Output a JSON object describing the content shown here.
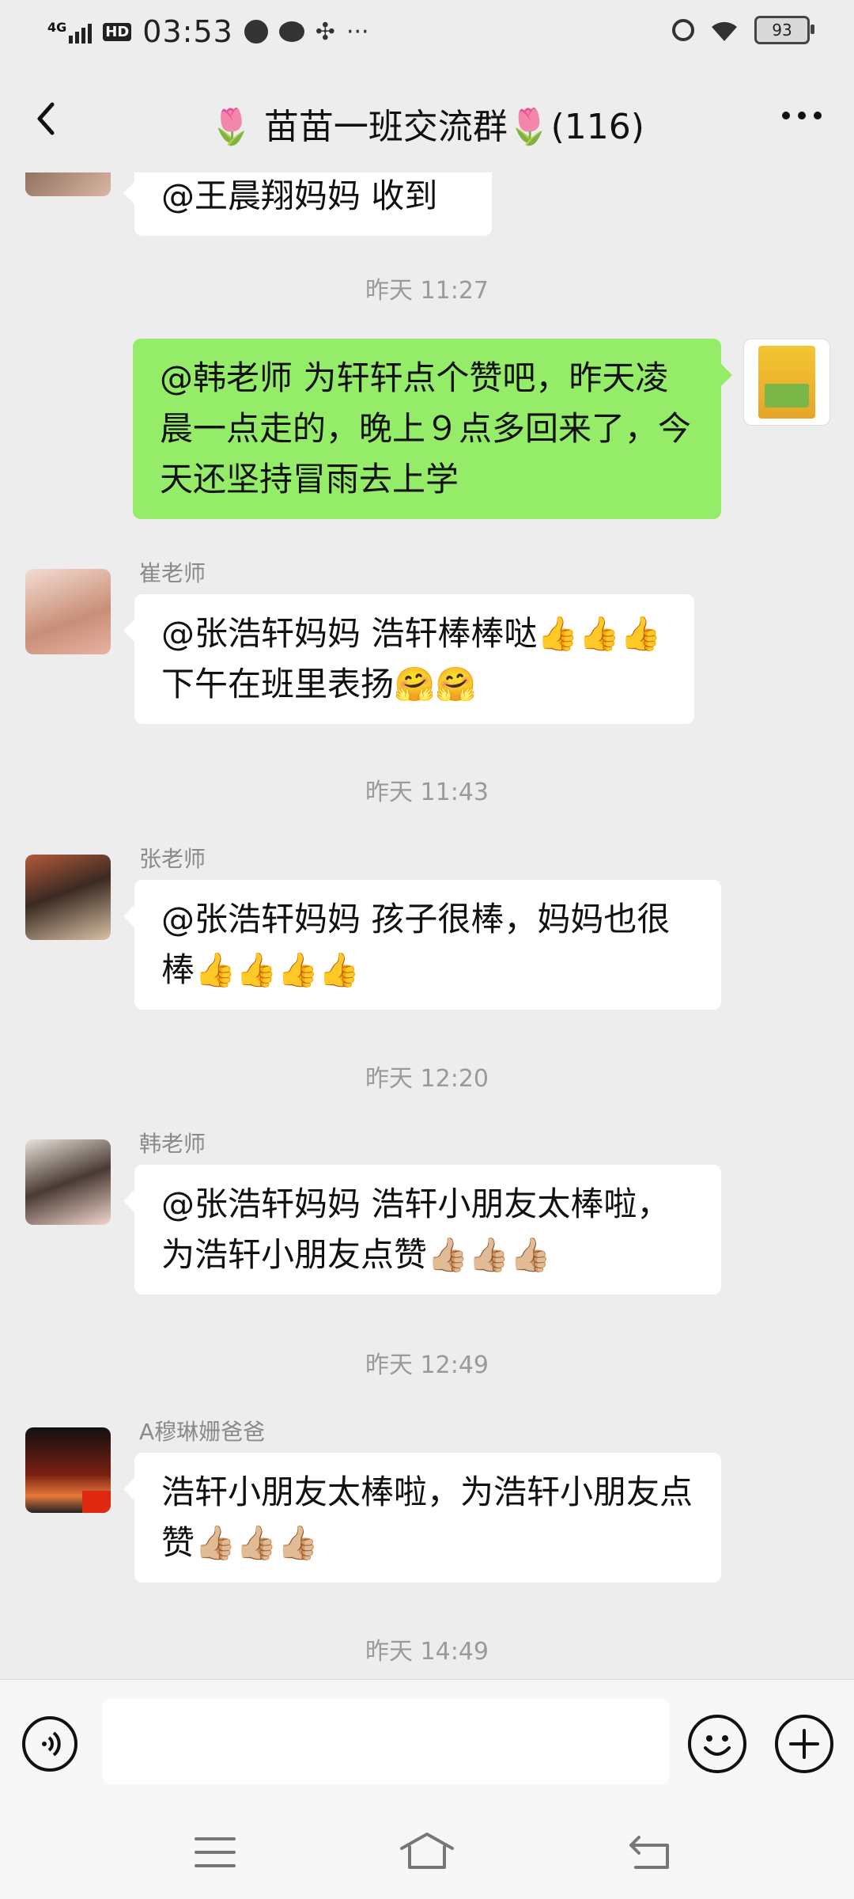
{
  "status_bar": {
    "network": "4G",
    "hd": "HD",
    "time": "03:53",
    "more": "···",
    "battery": "93"
  },
  "header": {
    "back_icon": "chevron-left-icon",
    "title": "🌷 苗苗一班交流群🌷(116)",
    "more_icon": "more-horizontal-icon"
  },
  "messages": [
    {
      "type": "incoming",
      "text": "@王晨翔妈妈  收到"
    },
    {
      "type": "time",
      "text": "昨天 11:27"
    },
    {
      "type": "outgoing",
      "text": "@韩老师  为轩轩点个赞吧，昨天凌晨一点走的，晚上９点多回来了，今天还坚持冒雨去上学"
    },
    {
      "type": "incoming",
      "sender": "崔老师",
      "text": "@张浩轩妈妈  浩轩棒棒哒👍👍👍下午在班里表扬🤗🤗"
    },
    {
      "type": "time",
      "text": "昨天 11:43"
    },
    {
      "type": "incoming",
      "sender": "张老师",
      "text": "@张浩轩妈妈  孩子很棒，妈妈也很棒👍👍👍👍"
    },
    {
      "type": "time",
      "text": "昨天 12:20"
    },
    {
      "type": "incoming",
      "sender": "韩老师",
      "text": "@张浩轩妈妈  浩轩小朋友太棒啦，为浩轩小朋友点赞👍🏼👍🏼👍🏼"
    },
    {
      "type": "time",
      "text": "昨天 12:49"
    },
    {
      "type": "incoming",
      "sender": "A穆琳姗爸爸",
      "text": " 浩轩小朋友太棒啦，为浩轩小朋友点赞👍🏼👍🏼👍🏼"
    },
    {
      "type": "time",
      "text": "昨天 14:49"
    }
  ],
  "input_bar": {
    "voice_icon": "voice-icon",
    "input_value": "",
    "emoji_icon": "smiley-icon",
    "plus_icon": "plus-icon"
  },
  "system_nav": {
    "menu_icon": "menu-icon",
    "home_icon": "home-icon",
    "back_icon": "back-icon"
  },
  "colors": {
    "background": "#ededed",
    "outgoing_bubble": "#95ec69",
    "incoming_bubble": "#ffffff",
    "time_text": "#9a9a9a"
  }
}
